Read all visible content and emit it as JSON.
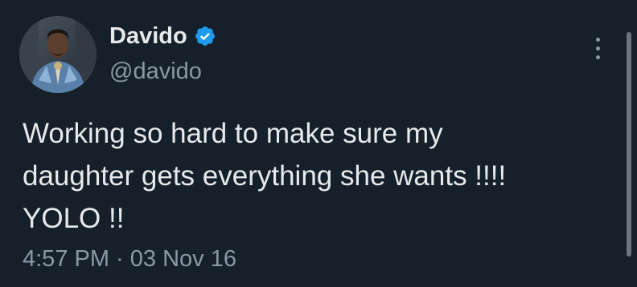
{
  "tweet": {
    "display_name": "Davido",
    "handle": "@davido",
    "verified": true,
    "verified_icon": "verified-badge-icon",
    "text": "Working so hard to make sure my\ndaughter gets everything she wants !!!!\nYOLO !!",
    "timestamp": "4:57 PM · 03 Nov 16",
    "more_icon": "more-vertical-icon"
  },
  "colors": {
    "background": "#15202b",
    "primary_text": "#e7e9ea",
    "secondary_text": "#8b98a5",
    "verified": "#1d9bf0"
  }
}
